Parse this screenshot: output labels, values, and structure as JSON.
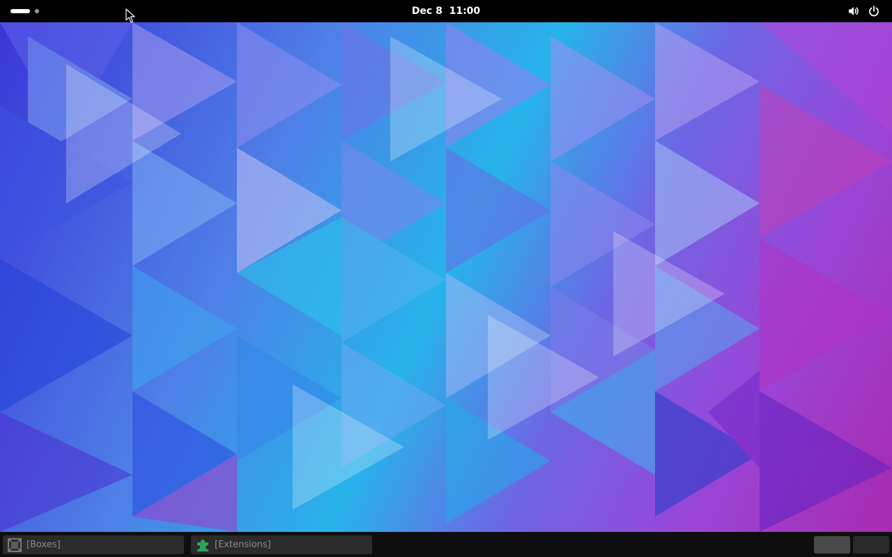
{
  "top_bar": {
    "clock_date": "Dec 8",
    "clock_time": "11:00",
    "icons": [
      "volume-icon",
      "power-icon"
    ]
  },
  "taskbar": {
    "items": [
      {
        "label": "[Boxes]",
        "icon": "boxes-icon"
      },
      {
        "label": "[Extensions]",
        "icon": "extensions-puzzle-icon"
      }
    ],
    "workspaces": [
      "workspace-1",
      "workspace-2"
    ]
  },
  "colors": {
    "panel_bg": "#000000",
    "taskbar_bg": "#0e0e0e",
    "task_label": "#8c8c8c",
    "extensions_icon": "#2fa35a"
  }
}
